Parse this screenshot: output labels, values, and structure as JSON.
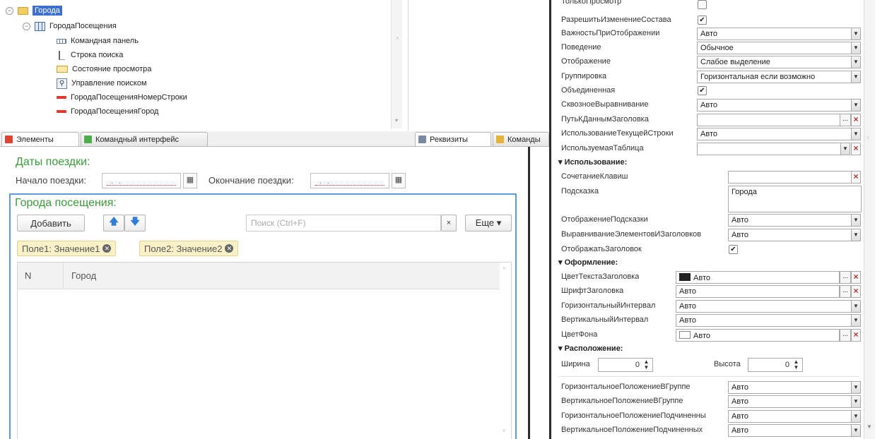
{
  "tree": {
    "root_label": "Города",
    "table_label": "ГородаПосещения",
    "children": [
      {
        "label": "Командная панель",
        "icon": "command-bar-icon"
      },
      {
        "label": "Строка поиска",
        "icon": "input-field-icon"
      },
      {
        "label": "Состояние просмотра",
        "icon": "view-state-icon"
      },
      {
        "label": "Управление поиском",
        "icon": "search-control-icon"
      },
      {
        "label": "ГородаПосещенияНомерСтроки",
        "icon": "field-icon"
      },
      {
        "label": "ГородаПосещенияГород",
        "icon": "field-icon"
      }
    ]
  },
  "tabs_left": [
    {
      "label": "Элементы",
      "icon_color": "#e0432f"
    },
    {
      "label": "Командный интерфейс",
      "icon_color": "#4bb04b"
    }
  ],
  "tabs_mid": [
    {
      "label": "Реквизиты",
      "icon_color": "#7a8aa3"
    },
    {
      "label": "Команды",
      "icon_color": "#e2b53a"
    }
  ],
  "form": {
    "dates_group_title": "Даты поездки:",
    "start_label": "Начало поездки:",
    "end_label": "Окончание поездки:",
    "date_mask": ". .",
    "cities_group_title": "Города посещения:",
    "add_button": "Добавить",
    "search_placeholder": "Поиск (Ctrl+F)",
    "clear_glyph": "×",
    "more_button": "Еще ▾",
    "chips": [
      {
        "text": "Поле1: Значение1"
      },
      {
        "text": "Поле2: Значение2"
      }
    ],
    "columns": [
      "N",
      "Город"
    ]
  },
  "props": {
    "rows_top": [
      {
        "label": "ТолькоПросмотр",
        "type": "check",
        "checked": false
      },
      {
        "label": "РазрешитьИзменениеСостава",
        "type": "check",
        "checked": true
      },
      {
        "label": "ВажностьПриОтображении",
        "type": "select",
        "value": "Авто"
      },
      {
        "label": "Поведение",
        "type": "select",
        "value": "Обычное"
      },
      {
        "label": "Отображение",
        "type": "select",
        "value": "Слабое выделение"
      },
      {
        "label": "Группировка",
        "type": "select",
        "value": "Горизонтальная если возможно"
      },
      {
        "label": "Объединенная",
        "type": "check",
        "checked": true
      },
      {
        "label": "СквозноеВыравнивание",
        "type": "select",
        "value": "Авто"
      },
      {
        "label": "ПутьКДаннымЗаголовка",
        "type": "ellipsis",
        "value": ""
      },
      {
        "label": "ИспользованиеТекущейСтроки",
        "type": "select",
        "value": "Авто"
      },
      {
        "label": "ИспользуемаяТаблица",
        "type": "selectx",
        "value": ""
      }
    ],
    "section_usage": "Использование:",
    "shortcut_label": "СочетаниеКлавиш",
    "hint_label": "Подсказка",
    "hint_value": "Города",
    "hint_display_label": "ОтображениеПодсказки",
    "hint_display_value": "Авто",
    "align_label": "ВыравниваниеЭлементовИЗаголовков",
    "align_value": "Авто",
    "show_title_label": "ОтображатьЗаголовок",
    "section_design": "Оформление:",
    "title_color_label": "ЦветТекстаЗаголовка",
    "title_color_value": "Авто",
    "title_font_label": "ШрифтЗаголовка",
    "title_font_value": "Авто",
    "h_interval_label": "ГоризонтальныйИнтервал",
    "h_interval_value": "Авто",
    "v_interval_label": "ВертикальныйИнтервал",
    "v_interval_value": "Авто",
    "bg_color_label": "ЦветФона",
    "bg_color_value": "Авто",
    "section_layout": "Расположение:",
    "width_label": "Ширина",
    "width_value": "0",
    "height_label": "Высота",
    "height_value": "0",
    "rows_bottom": [
      {
        "label": "ГоризонтальноеПоложениеВГруппе",
        "value": "Авто"
      },
      {
        "label": "ВертикальноеПоложениеВГруппе",
        "value": "Авто"
      },
      {
        "label": "ГоризонтальноеПоложениеПодчиненны",
        "value": "Авто"
      },
      {
        "label": "ВертикальноеПоложениеПодчиненных",
        "value": "Авто"
      }
    ]
  }
}
